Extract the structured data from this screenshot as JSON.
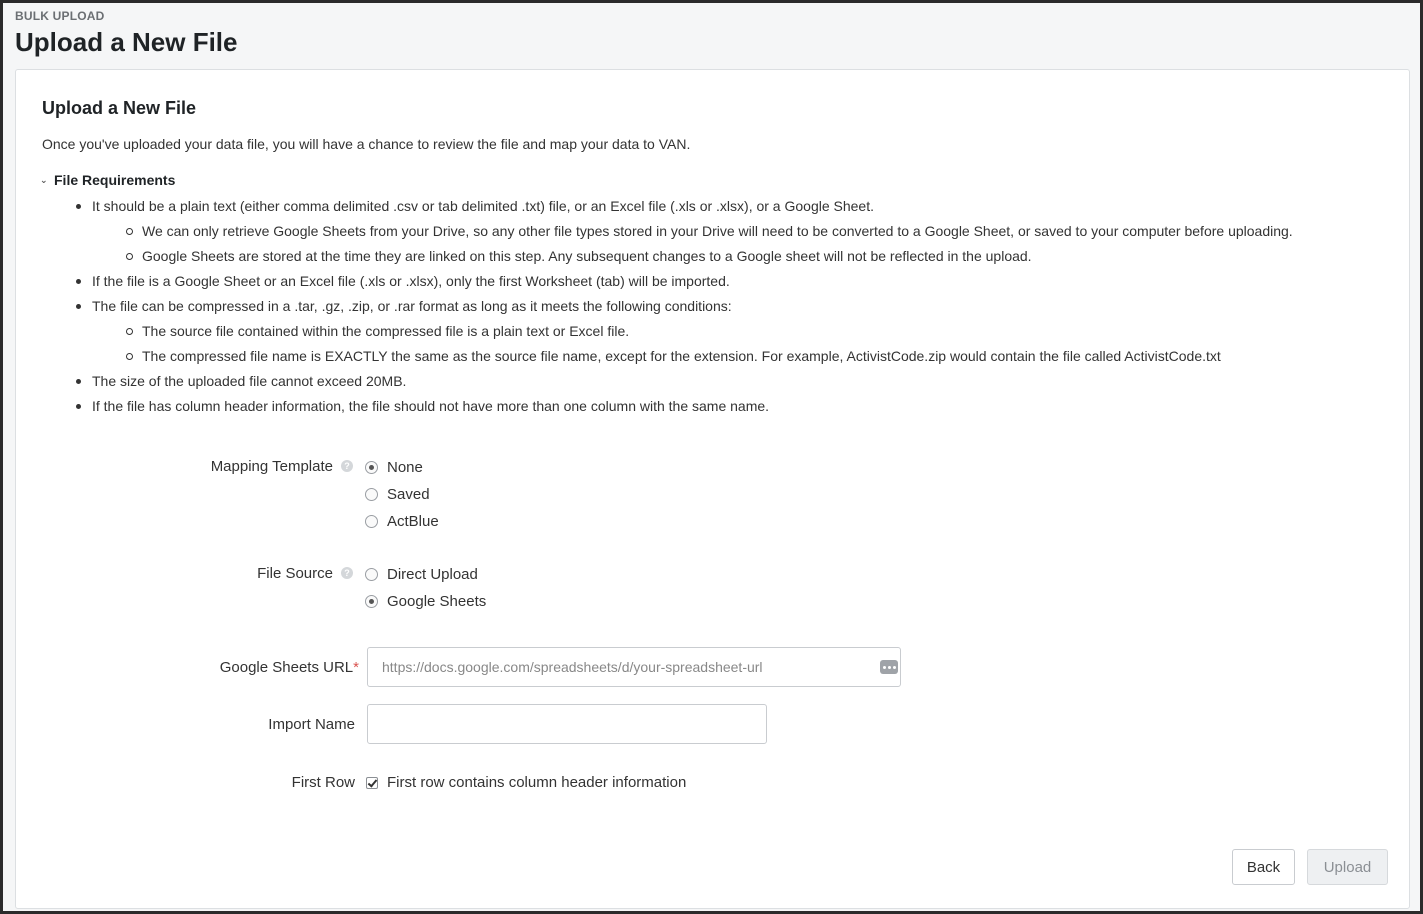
{
  "header": {
    "eyebrow": "BULK UPLOAD",
    "title": "Upload a New File"
  },
  "card": {
    "title": "Upload a New File",
    "intro": "Once you've uploaded your data file, you will have a chance to review the file and map your data to VAN.",
    "requirements_toggle": "File Requirements",
    "requirements": [
      {
        "level": 1,
        "text": "It should be a plain text (either comma delimited .csv or tab delimited .txt) file, or an Excel file (.xls or .xlsx), or a Google Sheet."
      },
      {
        "level": 2,
        "text": "We can only retrieve Google Sheets from your Drive, so any other file types stored in your Drive will need to be converted to a Google Sheet, or saved to your computer before uploading."
      },
      {
        "level": 2,
        "text": "Google Sheets are stored at the time they are linked on this step. Any subsequent changes to a Google sheet will not be reflected in the upload."
      },
      {
        "level": 1,
        "text": "If the file is a Google Sheet or an Excel file (.xls or .xlsx), only the first Worksheet (tab) will be imported."
      },
      {
        "level": 1,
        "text": "The file can be compressed in a .tar, .gz, .zip, or .rar format as long as it meets the following conditions:"
      },
      {
        "level": 2,
        "text": "The source file contained within the compressed file is a plain text or Excel file."
      },
      {
        "level": 2,
        "text": "The compressed file name is EXACTLY the same as the source file name, except for the extension. For example, ActivistCode.zip would contain the file called ActivistCode.txt"
      },
      {
        "level": 1,
        "text": "The size of the uploaded file cannot exceed 20MB."
      },
      {
        "level": 1,
        "text": "If the file has column header information, the file should not have more than one column with the same name."
      }
    ]
  },
  "form": {
    "mapping_template": {
      "label": "Mapping Template",
      "options": [
        "None",
        "Saved",
        "ActBlue"
      ],
      "selected": "None"
    },
    "file_source": {
      "label": "File Source",
      "options": [
        "Direct Upload",
        "Google Sheets"
      ],
      "selected": "Google Sheets"
    },
    "sheets_url": {
      "label": "Google Sheets URL",
      "required_mark": "*",
      "placeholder": "https://docs.google.com/spreadsheets/d/your-spreadsheet-url",
      "value": ""
    },
    "import_name": {
      "label": "Import Name",
      "value": ""
    },
    "first_row": {
      "label": "First Row",
      "checkbox_label": "First row contains column header information",
      "checked": true
    }
  },
  "actions": {
    "back": "Back",
    "upload": "Upload"
  }
}
